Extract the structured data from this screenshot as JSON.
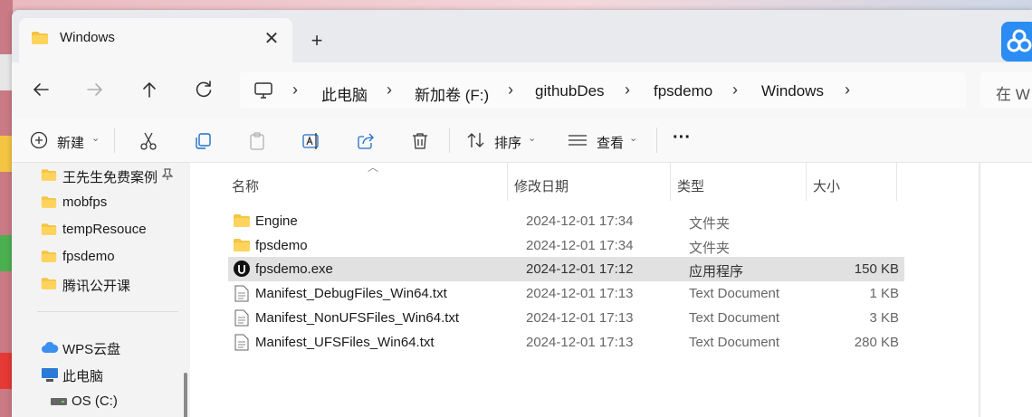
{
  "window": {
    "tab_title": "Windows",
    "tab_close": "✕",
    "new_tab": "+"
  },
  "breadcrumb": {
    "items": [
      "此电脑",
      "新加卷 (F:)",
      "githubDes",
      "fpsdemo",
      "Windows"
    ],
    "separator": "›"
  },
  "search": {
    "text": "在 W"
  },
  "toolbar": {
    "new_label": "新建",
    "sort_label": "排序",
    "view_label": "查看",
    "more_label": "···",
    "caret": "⌄"
  },
  "sidebar": {
    "quick_access": [
      {
        "label": "王先生免费案例",
        "pinned": true
      },
      {
        "label": "mobfps"
      },
      {
        "label": "tempResouce"
      },
      {
        "label": "fpsdemo"
      },
      {
        "label": "腾讯公开课"
      }
    ],
    "wps_label": "WPS云盘",
    "this_pc_label": "此电脑",
    "drive_label": "OS (C:)"
  },
  "columns": {
    "name": "名称",
    "date": "修改日期",
    "type": "类型",
    "size": "大小"
  },
  "files": [
    {
      "name": "Engine",
      "date": "2024-12-01 17:34",
      "type": "文件夹",
      "size": "",
      "icon": "folder-icon"
    },
    {
      "name": "fpsdemo",
      "date": "2024-12-01 17:34",
      "type": "文件夹",
      "size": "",
      "icon": "folder-icon"
    },
    {
      "name": "fpsdemo.exe",
      "date": "2024-12-01 17:12",
      "type": "应用程序",
      "size": "150 KB",
      "icon": "unreal-app-icon",
      "selected": true
    },
    {
      "name": "Manifest_DebugFiles_Win64.txt",
      "date": "2024-12-01 17:13",
      "type": "Text Document",
      "size": "1 KB",
      "icon": "text-file-icon"
    },
    {
      "name": "Manifest_NonUFSFiles_Win64.txt",
      "date": "2024-12-01 17:13",
      "type": "Text Document",
      "size": "3 KB",
      "icon": "text-file-icon"
    },
    {
      "name": "Manifest_UFSFiles_Win64.txt",
      "date": "2024-12-01 17:13",
      "type": "Text Document",
      "size": "280 KB",
      "icon": "text-file-icon"
    }
  ],
  "colors": {
    "folder": "#f4c443",
    "selection": "#e1e1e1",
    "accent": "#2b8cf3"
  }
}
